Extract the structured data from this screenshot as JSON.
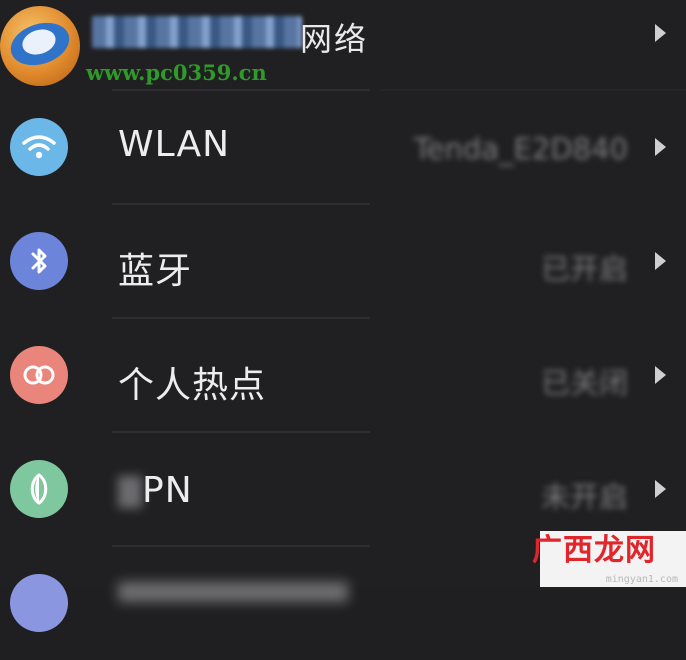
{
  "header": {
    "title": "网络"
  },
  "watermark": {
    "site_url": "www.pc0359.cn",
    "brand_cn": "广西龙网",
    "brand_url": "mingyan1.com"
  },
  "rows": [
    {
      "label": "WLAN",
      "status": "Tenda_E2D840",
      "icon": "wifi-icon",
      "icon_color": "#6bb7e8"
    },
    {
      "label": "蓝牙",
      "status": "已开启",
      "icon": "bluetooth-icon",
      "icon_color": "#6c84d9"
    },
    {
      "label": "个人热点",
      "status": "已关闭",
      "icon": "hotspot-icon",
      "icon_color": "#e9857a"
    },
    {
      "label": "PN",
      "status": "未开启",
      "icon": "vpn-icon",
      "icon_color": "#7fc79e"
    }
  ],
  "colors": {
    "background": "#202022",
    "text": "#ededee",
    "watermark_red": "#e0262b",
    "watermark_green": "#2f9a2a"
  }
}
